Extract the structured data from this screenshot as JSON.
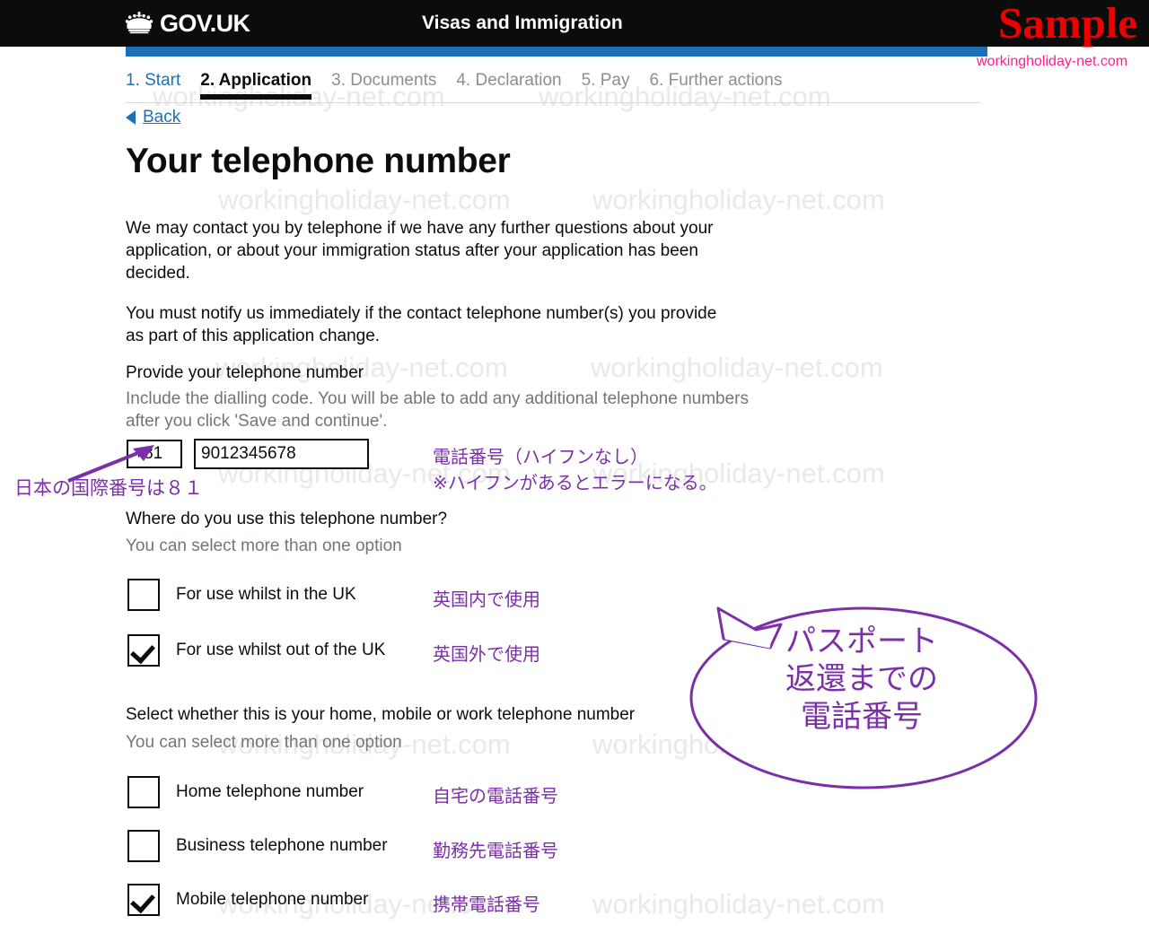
{
  "header": {
    "logo_text": "GOV.UK",
    "crown_icon": "crown-icon",
    "service_name": "Visas and Immigration",
    "sample_watermark": "Sample",
    "site_url": "workingholiday-net.com",
    "black": "#0b0c0c",
    "blue": "#1d70b8",
    "sample_color": "#ee0000",
    "url_color": "#ff1e8e"
  },
  "phase_nav": [
    {
      "label": "1. Start",
      "state": "link"
    },
    {
      "label": "2. Application",
      "state": "current"
    },
    {
      "label": "3. Documents",
      "state": "muted"
    },
    {
      "label": "4. Declaration",
      "state": "muted"
    },
    {
      "label": "5. Pay",
      "state": "muted"
    },
    {
      "label": "6. Further actions",
      "state": "muted"
    }
  ],
  "back": {
    "label": "Back",
    "icon": "left-triangle-icon"
  },
  "main": {
    "title": "Your telephone number",
    "paragraph_1": "We may contact you by telephone if we have any further questions about your application, or about your immigration status after your application has been decided.",
    "paragraph_2": "You must notify us immediately if the contact telephone number(s) you provide as part of this application change.",
    "field_label": "Provide your telephone number",
    "field_hint": "Include the dialling code. You will be able to add any additional telephone numbers after you click 'Save and continue'.",
    "dialling_code_value": "+81",
    "telephone_value": "9012345678"
  },
  "question_1": {
    "legend": "Where do you use this telephone number?",
    "hint": "You can select more than one option",
    "options": [
      {
        "label": "For use whilst in the UK",
        "checked": false,
        "annotation": "英国内で使用"
      },
      {
        "label": "For use whilst out of the UK",
        "checked": true,
        "annotation": "英国外で使用"
      }
    ]
  },
  "question_2": {
    "legend": "Select whether this is your home, mobile or work telephone number",
    "hint": "You can select more than one option",
    "options": [
      {
        "label": "Home telephone number",
        "checked": false,
        "annotation": "自宅の電話番号"
      },
      {
        "label": "Business telephone number",
        "checked": false,
        "annotation": "勤務先電話番号"
      },
      {
        "label": "Mobile telephone number",
        "checked": true,
        "annotation": "携帯電話番号"
      }
    ]
  },
  "annotations": {
    "color": "#7b2fa8",
    "dialling_code_note": "日本の国際番号は８１",
    "phone_note_line1": "電話番号（ハイフンなし）",
    "phone_note_line2": "※ハイフンがあるとエラーになる。",
    "bubble_line1": "パスポート",
    "bubble_line2": "返還までの",
    "bubble_line3": "電話番号"
  },
  "watermark": {
    "text": "workingholiday-net.com",
    "color": "#e9e9e9"
  }
}
